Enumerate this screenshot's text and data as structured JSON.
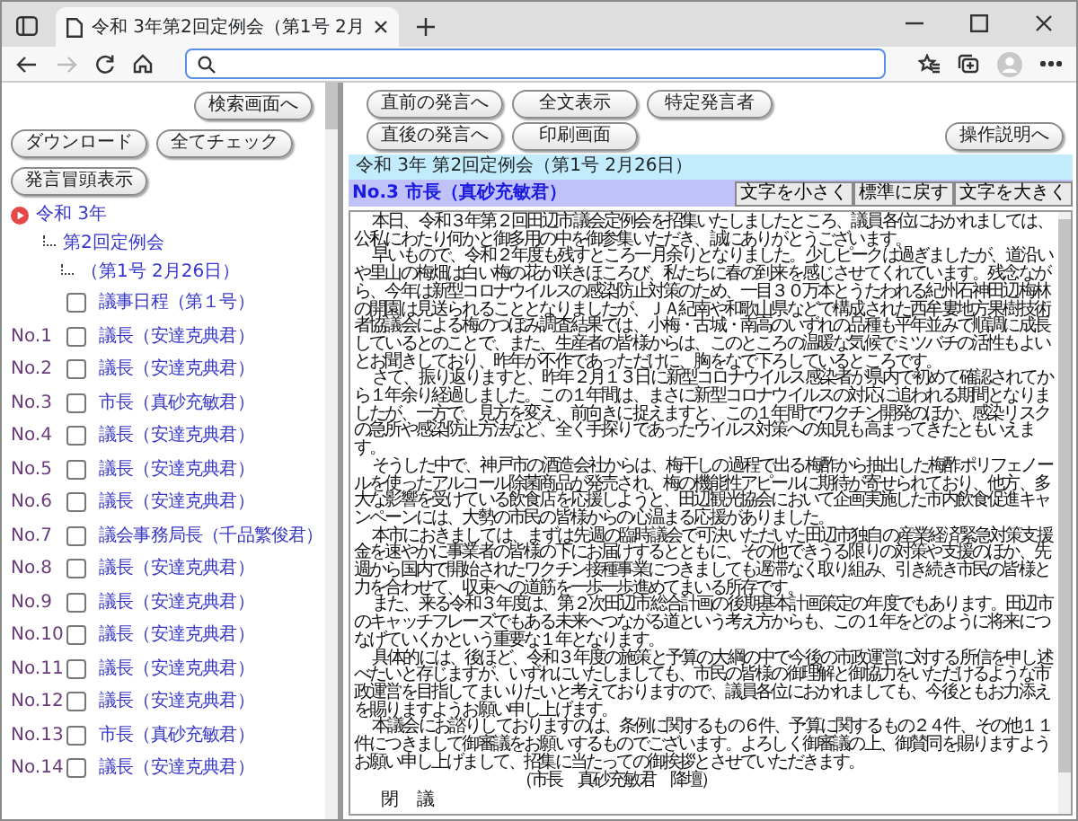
{
  "browser": {
    "tab_title": "令和 3年第2回定例会（第1号 2月"
  },
  "left_pane": {
    "search_button": "検索画面へ",
    "buttons": [
      "ダウンロード",
      "全てチェック"
    ],
    "summary_button": "発言冒頭表示",
    "tree": [
      {
        "label": "令和 3年",
        "children": [
          {
            "label": "第2回定例会",
            "children": [
              {
                "label": "（第1号 2月26日）"
              }
            ]
          }
        ]
      }
    ],
    "items": [
      {
        "label": "議事日程（第１号）",
        "checked": false
      },
      {
        "number": "No.1",
        "label": "議長（安達克典君）",
        "checked": false
      },
      {
        "number": "No.2",
        "label": "議長（安達克典君）",
        "checked": false
      },
      {
        "number": "No.3",
        "label": "市長（真砂充敏君）",
        "checked": false
      },
      {
        "number": "No.4",
        "label": "議長（安達克典君）",
        "checked": false
      },
      {
        "number": "No.5",
        "label": "議長（安達克典君）",
        "checked": false
      },
      {
        "number": "No.6",
        "label": "議長（安達克典君）",
        "checked": false
      },
      {
        "number": "No.7",
        "label": "議会事務局長（千品繁俊君）",
        "checked": false
      },
      {
        "number": "No.8",
        "label": "議長（安達克典君）",
        "checked": false
      },
      {
        "number": "No.9",
        "label": "議長（安達克典君）",
        "checked": false
      },
      {
        "number": "No.10",
        "label": "議長（安達克典君）",
        "checked": false
      },
      {
        "number": "No.11",
        "label": "議長（安達克典君）",
        "checked": false
      },
      {
        "number": "No.12",
        "label": "議長（安達克典君）",
        "checked": false
      },
      {
        "number": "No.13",
        "label": "市長（真砂充敏君）",
        "checked": false
      },
      {
        "number": "No.14",
        "label": "議長（安達克典君）",
        "checked": false
      }
    ]
  },
  "right_pane": {
    "button_rows": [
      [
        "直前の発言へ",
        "全文表示",
        "特定発言者"
      ],
      [
        "直後の発言へ",
        "印刷画面"
      ]
    ],
    "help_button": "操作説明へ",
    "title": "令和 3年 第2回定例会（第1号 2月26日）",
    "speaker": "No.3 市長（真砂充敏君）",
    "font_buttons": [
      "文字を小さく",
      "標準に戻す",
      "文字を大きく"
    ],
    "paragraphs": [
      {
        "kind": "body",
        "text": "本日、令和３年第２回田辺市議会定例会を招集いたしましたところ、議員各位におかれましては、公私にわたり何かと御多用の中を御参集いただき、誠にありがとうございます。"
      },
      {
        "kind": "body",
        "text": "早いもので、令和２年度も残すところ一月余りとなりました。少しピークは過ぎましたが、道沿いや里山の梅畑は白い梅の花が咲きほころび、私たちに春の到来を感じさせてくれています。残念ながら、今年は新型コロナウイルスの感染防止対策のため、一目３０万本とうたわれる紀州石神田辺梅林の開園は見送られることとなりましたが、ＪＡ紀南や和歌山県などで構成された西牟婁地方果樹技術者協議会による梅のつぼみ調査結果では、小梅・古城・南高のいずれの品種も平年並みで順調に成長しているとのことで、また、生産者の皆様からは、このところの温暖な気候でミツバチの活性もよいとお聞きしており、昨年が不作であっただけに、胸をなで下ろしているところです。"
      },
      {
        "kind": "body",
        "text": "さて、振り返りますと、昨年２月１３日に新型コロナウイルス感染者が県内で初めて確認されてから１年余り経過しました。この１年間は、まさに新型コロナウイルスの対応に追われる期間となりましたが、一方で、見方を変え、前向きに捉えますと、この１年間でワクチン開発のほか、感染リスクの急所や感染防止方法など、全く手探りであったウイルス対策への知見も高まってきたともいえます。"
      },
      {
        "kind": "body",
        "text": "そうした中で、神戸市の酒造会社からは、梅干しの過程で出る梅酢から抽出した梅酢ポリフェノールを使ったアルコール除菌商品が発売され、梅の機能性アピールに期待が寄せられており、他方、多大な影響を受けている飲食店を応援しようと、田辺観光協会において企画実施した市内飲食促進キャンペーンには、大勢の市民の皆様からの心温まる応援がありました。"
      },
      {
        "kind": "body",
        "text": "本市におきましては、まずは先週の臨時議会で可決いただいた田辺市独自の産業経済緊急対策支援金を速やかに事業者の皆様の下にお届けするとともに、その他できうる限りの対策や支援のほか、先週から国内で開始されたワクチン接種事業につきましても遅滞なく取り組み、引き続き市民の皆様と力を合わせて、収束への道筋を一歩一歩進めてまいる所存です。"
      },
      {
        "kind": "body",
        "text": "また、来る令和３年度は、第２次田辺市総合計画の後期基本計画策定の年度でもあります。田辺市のキャッチフレーズでもある未来へつながる道という考え方からも、この１年をどのように将来につなげていくかという重要な１年となります。"
      },
      {
        "kind": "body",
        "text": "具体的には、後ほど、令和３年度の施策と予算の大綱の中で今後の市政運営に対する所信を申し述べたいと存じますが、いずれにいたしましても、市民の皆様の御理解と御協力をいただけるような市政運営を目指してまいりたいと考えておりますので、議員各位におかれましても、今後ともお力添えを賜りますようお願い申し上げます。"
      },
      {
        "kind": "body",
        "text": "本議会にお諮りしておりますのは、条例に関するもの６件、予算に関するもの２４件、その他１１件につきまして御審議をお願いするものでございます。よろしく御審議の上、御賛同を賜りますようお願い申し上げまして、招集に当たっての御挨拶とさせていただきます。"
      },
      {
        "kind": "stage",
        "text": "（市長　真砂充敏君　降壇）"
      },
      {
        "kind": "closing",
        "text": "閉　議"
      }
    ]
  }
}
